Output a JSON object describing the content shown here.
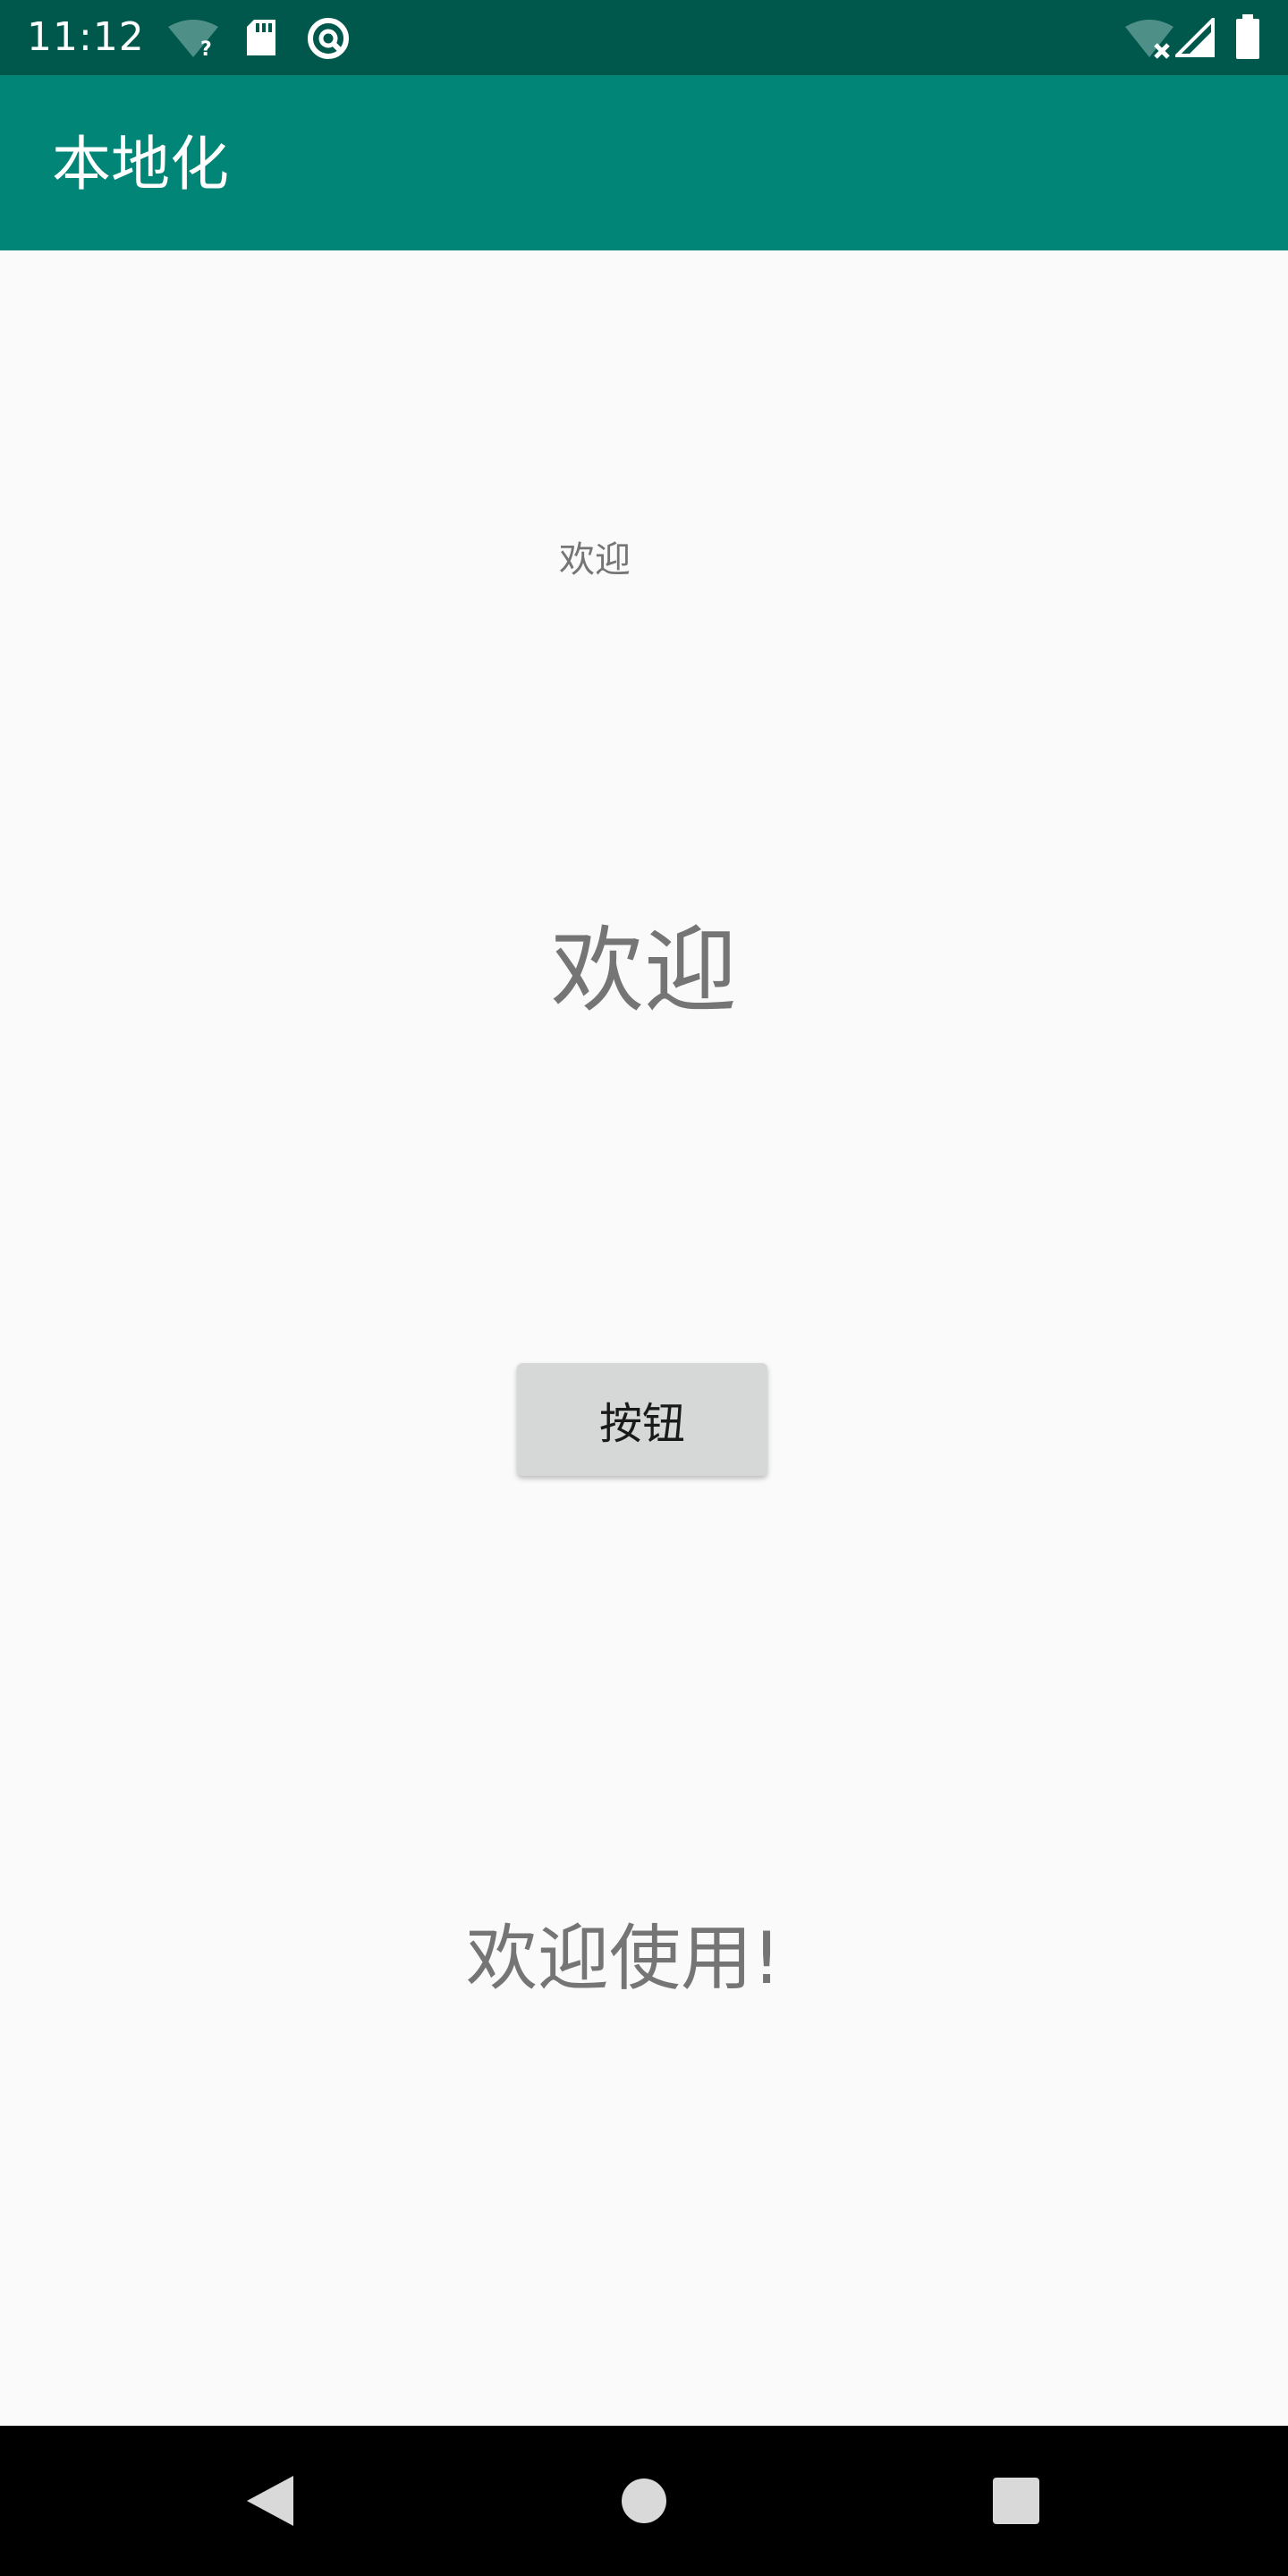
{
  "status_bar": {
    "time": "11:12",
    "icons": [
      "wifi-unknown-icon",
      "sd-card-icon",
      "at-sign-icon",
      "wifi-off-icon",
      "signal-icon",
      "battery-icon"
    ]
  },
  "app_bar": {
    "title": "本地化"
  },
  "content": {
    "text_small": "欢迎",
    "text_large": "欢迎",
    "button_label": "按钮",
    "text_welcome": "欢迎使用!"
  },
  "nav_bar": {
    "icons": [
      "back-icon",
      "home-icon",
      "recents-icon"
    ]
  },
  "colors": {
    "status_bar": "#00574b",
    "app_bar": "#008577",
    "background": "#fafafa",
    "button": "#d6d7d7",
    "secondary_text": "#757575"
  }
}
